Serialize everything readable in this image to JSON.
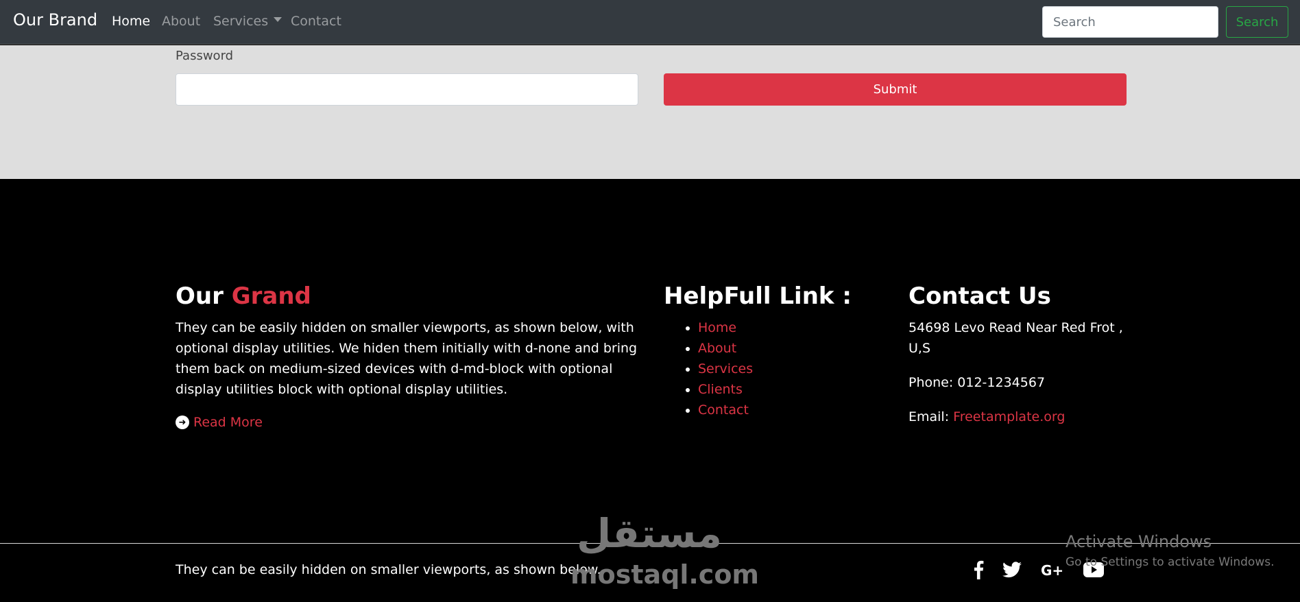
{
  "navbar": {
    "brand": "Our Brand",
    "links": [
      {
        "label": "Home"
      },
      {
        "label": "About"
      },
      {
        "label": "Services"
      },
      {
        "label": "Contact"
      }
    ],
    "search_placeholder": "Search",
    "search_button": "Search"
  },
  "form": {
    "password_label": "Password",
    "password_value": "",
    "submit_label": "Submit"
  },
  "footer": {
    "about": {
      "title_plain": "Our",
      "title_accent": "Grand",
      "text": "They can be easily hidden on smaller viewports, as shown below, with optional display utilities. We hiden them initially with d-none and bring them back on medium-sized devices with d-md-block with optional display utilities block with optional display utilities.",
      "read_more": "Read More"
    },
    "links": {
      "title": "HelpFull Link :",
      "items": [
        "Home",
        "About",
        "Services",
        "Clients",
        "Contact"
      ]
    },
    "contact": {
      "title": "Contact Us",
      "address": "54698 Levo Read Near Red Frot , U,S",
      "phone": "Phone: 012-1234567",
      "email_label": "Email:",
      "email_value": "Freetamplate.org"
    },
    "bottom_text": "They can be easily hidden on smaller viewports, as shown below.",
    "social_icons": [
      "facebook-icon",
      "twitter-icon",
      "google-plus-icon",
      "youtube-icon"
    ]
  },
  "watermark": {
    "arabic": "مستقل",
    "latin": "mostaql.com"
  },
  "activation": {
    "title": "Activate Windows",
    "subtitle": "Go to Settings to activate Windows."
  },
  "colors": {
    "navbar": "#343a40",
    "accent": "#dc3545",
    "success": "#28a745",
    "form_bg": "#dedede",
    "footer_bg": "#000000"
  }
}
